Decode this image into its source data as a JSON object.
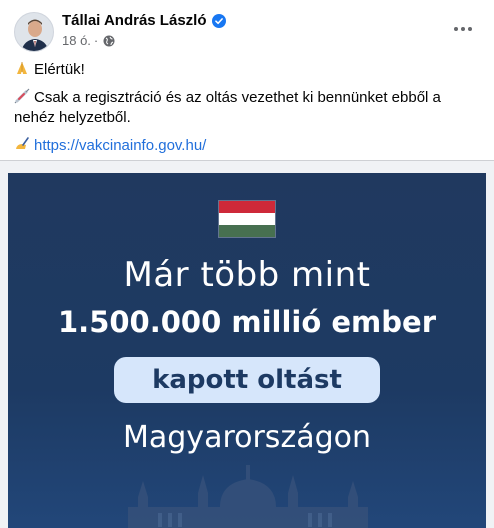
{
  "post": {
    "author": "Tállai András László",
    "time": "18 ó.",
    "lines": [
      {
        "icon": "folded-hands-emoji",
        "text": "Elértük!"
      },
      {
        "icon": "syringe-emoji",
        "text": "Csak a regisztráció és az oltás vezethet ki bennünket ebből a nehéz helyzetből."
      },
      {
        "icon": "writing-hand-emoji",
        "text": "https://vakcinainfo.gov.hu/"
      }
    ]
  },
  "graphic": {
    "line1": "Már több mint",
    "line2": "1.500.000 millió ember",
    "line3": "kapott oltást",
    "line4": "Magyarországon",
    "flag_colors": [
      "#ce2939",
      "#ffffff",
      "#477050"
    ]
  },
  "colors": {
    "link": "#216fdb",
    "graphic_bg": "#1d3a63",
    "pill_bg": "#d6e6fb"
  }
}
